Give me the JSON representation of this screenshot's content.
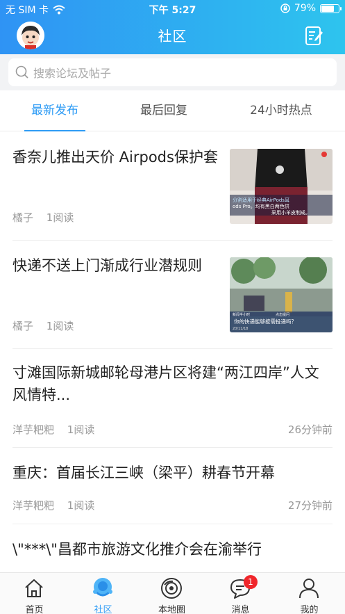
{
  "status_bar": {
    "carrier": "无 SIM 卡",
    "time": "下午 5:27",
    "battery": "79%",
    "battery_level": 0.79
  },
  "nav": {
    "title": "社区"
  },
  "search": {
    "placeholder": "搜索论坛及帖子"
  },
  "tabs": [
    {
      "label": "最新发布",
      "active": true
    },
    {
      "label": "最后回复",
      "active": false
    },
    {
      "label": "24小时热点",
      "active": false
    }
  ],
  "posts": [
    {
      "title": "香奈儿推出天价 Airpods保护套",
      "author": "橘子",
      "reads": "1阅读",
      "time": "",
      "has_thumb": true
    },
    {
      "title": "快递不送上门渐成行业潜规则",
      "author": "橘子",
      "reads": "1阅读",
      "time": "",
      "has_thumb": true
    },
    {
      "title": "寸滩国际新城邮轮母港片区将建“两江四岸”人文风情特...",
      "author": "洋芋粑粑",
      "reads": "1阅读",
      "time": "26分钟前",
      "has_thumb": false
    },
    {
      "title": "重庆：首届长江三峡（梁平）耕春节开幕",
      "author": "洋芋粑粑",
      "reads": "1阅读",
      "time": "27分钟前",
      "has_thumb": false
    },
    {
      "title": "\\\"***\\\"昌都市旅游文化推介会在渝举行",
      "author": "",
      "reads": "",
      "time": "",
      "has_thumb": false
    }
  ],
  "thumb_captions": {
    "t1_line1": "分割适用于经典AirPods耳",
    "t1_line2": "ods Pro。均有黑白两色供",
    "t1_line3": "采用小羊皮制成。",
    "t2_header": "新闻半小时",
    "t2_tag": "点击提问",
    "t2_caption": "你的快递能够按需投递吗？",
    "t2_date": "20/11/18"
  },
  "tabbar": [
    {
      "label": "首页",
      "active": false,
      "icon": "home-icon"
    },
    {
      "label": "社区",
      "active": true,
      "icon": "community-icon"
    },
    {
      "label": "本地圈",
      "active": false,
      "icon": "local-circle-icon"
    },
    {
      "label": "消息",
      "active": false,
      "icon": "message-icon",
      "badge": "1"
    },
    {
      "label": "我的",
      "active": false,
      "icon": "profile-icon"
    }
  ],
  "colors": {
    "accent": "#2f9cf5",
    "header_start": "#2f93f4",
    "header_end": "#2ec4ee",
    "badge": "#f0262b"
  }
}
